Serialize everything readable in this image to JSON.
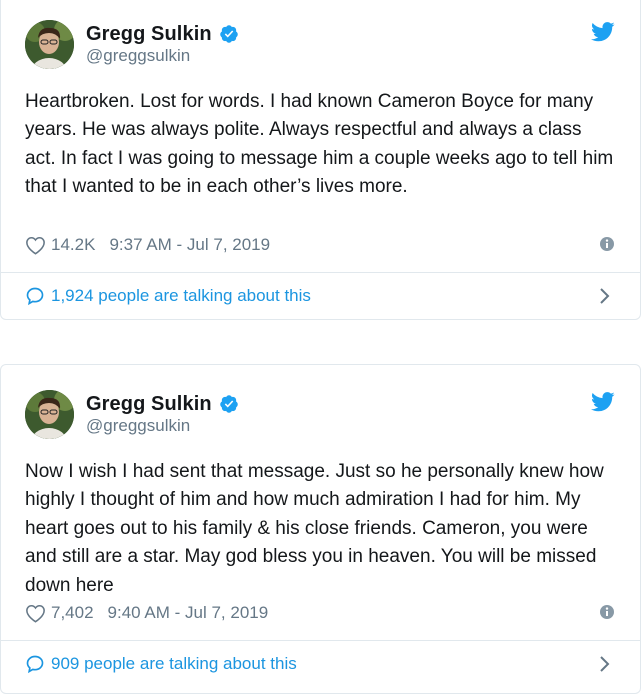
{
  "tweets": [
    {
      "display_name": "Gregg Sulkin",
      "handle": "@greggsulkin",
      "text": "Heartbroken. Lost for words. I had known Cameron Boyce for many years. He was always polite. Always respectful and always a class act. In fact I was going to message him a couple weeks ago to tell him that I wanted to be in each other’s lives more.",
      "likes": "14.2K",
      "timestamp": "9:37 AM - Jul 7, 2019",
      "talking": "1,924 people are talking about this"
    },
    {
      "display_name": "Gregg Sulkin",
      "handle": "@greggsulkin",
      "text": "Now I wish I had sent that message. Just so he personally knew how highly I thought of him and how much admiration I had for him. My heart goes out to his family & his close friends. Cameron, you were and still are a star. May god bless you in heaven. You will be missed down here",
      "likes": "7,402",
      "timestamp": "9:40 AM - Jul 7, 2019",
      "talking": "909 people are talking about this"
    }
  ],
  "colors": {
    "twitter_blue": "#1da1f2",
    "link_blue": "#1b95e0",
    "muted": "#657786",
    "border": "#e1e8ed"
  },
  "icons": [
    "verified-badge-icon",
    "twitter-bird-icon",
    "heart-icon",
    "info-icon",
    "speech-bubble-icon",
    "chevron-right-icon"
  ]
}
